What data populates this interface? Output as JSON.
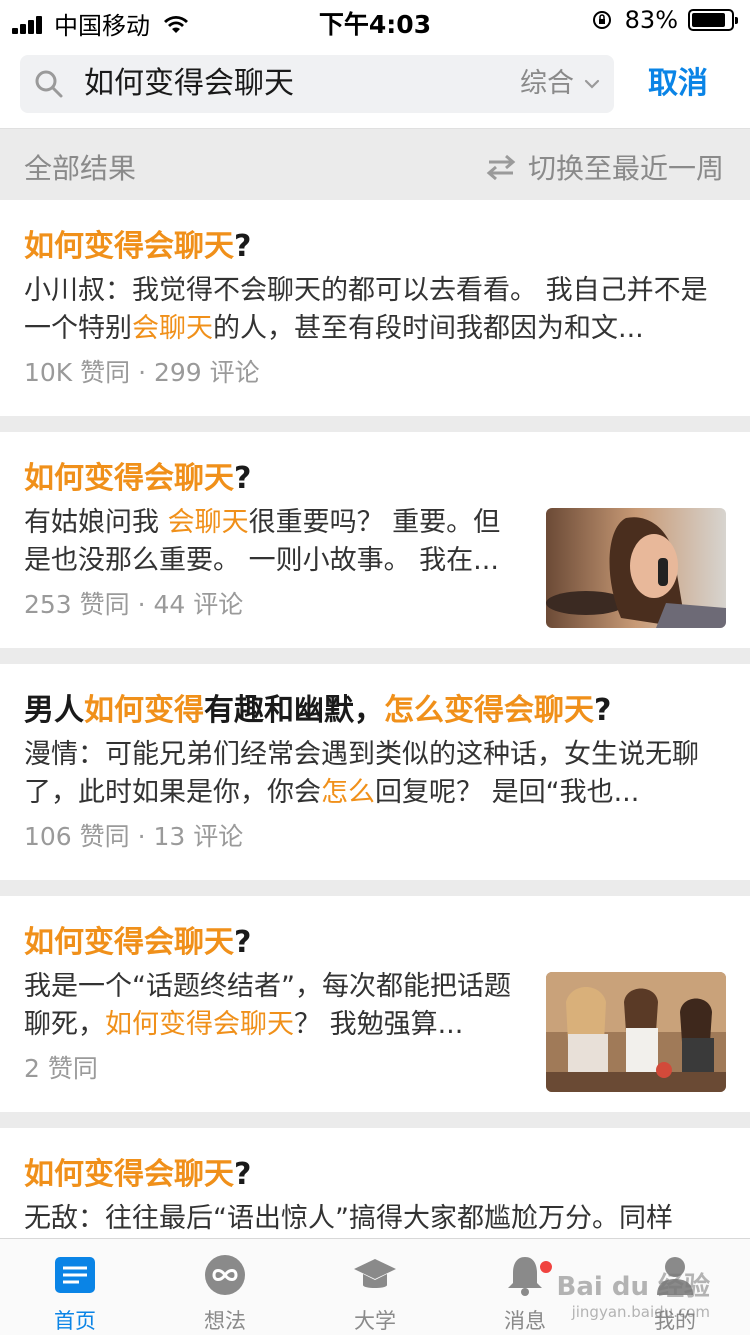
{
  "status_bar": {
    "carrier": "中国移动",
    "time": "下午4:03",
    "battery": "83%"
  },
  "search": {
    "query": "如何变得会聊天",
    "filter_label": "综合",
    "cancel_label": "取消"
  },
  "filter_row": {
    "all_results": "全部结果",
    "switch_label": "切换至最近一周"
  },
  "results": [
    {
      "title_parts": [
        {
          "t": "如何变得会聊天",
          "hl": true
        },
        {
          "t": "?",
          "hl": false
        }
      ],
      "excerpt_parts": [
        {
          "t": "小川叔：我觉得不会聊天的都可以去看看。 我自己并不是一个特别",
          "hl": false
        },
        {
          "t": "会聊天",
          "hl": true
        },
        {
          "t": "的人，甚至有段时间我都因为和文...",
          "hl": false
        }
      ],
      "meta": "10K 赞同 · 299 评论"
    },
    {
      "title_parts": [
        {
          "t": "如何变得会聊天",
          "hl": true
        },
        {
          "t": "?",
          "hl": false
        }
      ],
      "excerpt_parts": [
        {
          "t": "有姑娘问我 ",
          "hl": false
        },
        {
          "t": "会聊天",
          "hl": true
        },
        {
          "t": "很重要吗？ 重要。但是也没那么重要。 一则小故事。 我在...",
          "hl": false
        }
      ],
      "meta": "253 赞同 · 44 评论",
      "thumb": "woman-on-phone"
    },
    {
      "title_parts": [
        {
          "t": "男人",
          "hl": false
        },
        {
          "t": "如何变得",
          "hl": true
        },
        {
          "t": "有趣和幽默，",
          "hl": false
        },
        {
          "t": "怎么变得会聊天",
          "hl": true
        },
        {
          "t": "?",
          "hl": false
        }
      ],
      "excerpt_parts": [
        {
          "t": "漫情：可能兄弟们经常会遇到类似的这种话，女生说无聊了，此时如果是你，你会",
          "hl": false
        },
        {
          "t": "怎么",
          "hl": true
        },
        {
          "t": "回复呢？ 是回“我也...",
          "hl": false
        }
      ],
      "meta": "106 赞同 · 13 评论"
    },
    {
      "title_parts": [
        {
          "t": "如何变得会聊天",
          "hl": true
        },
        {
          "t": "?",
          "hl": false
        }
      ],
      "excerpt_parts": [
        {
          "t": "我是一个“话题终结者”，每次都能把话题聊死，",
          "hl": false
        },
        {
          "t": "如何变得会聊天",
          "hl": true
        },
        {
          "t": "？ 我勉强算...",
          "hl": false
        }
      ],
      "meta": "2 赞同",
      "thumb": "friends-laughing"
    },
    {
      "title_parts": [
        {
          "t": "如何变得会聊天",
          "hl": true
        },
        {
          "t": "?",
          "hl": false
        }
      ],
      "excerpt_parts": [
        {
          "t": "无敌：往往最后“语出惊人”搞得大家都尴尬万分。同样",
          "hl": false
        }
      ],
      "meta": ""
    }
  ],
  "tabbar": [
    {
      "label": "首页",
      "icon": "home-icon",
      "active": true
    },
    {
      "label": "想法",
      "icon": "idea-icon",
      "active": false
    },
    {
      "label": "大学",
      "icon": "graduation-cap-icon",
      "active": false
    },
    {
      "label": "消息",
      "icon": "bell-icon",
      "active": false
    },
    {
      "label": "我的",
      "icon": "profile-icon",
      "active": false
    }
  ],
  "watermark": {
    "text": "Bai du 经验",
    "sub": "jingyan.baidu.com"
  },
  "colors": {
    "accent": "#0a84e6",
    "highlight": "#f0901a",
    "background_gray": "#ebebeb"
  }
}
